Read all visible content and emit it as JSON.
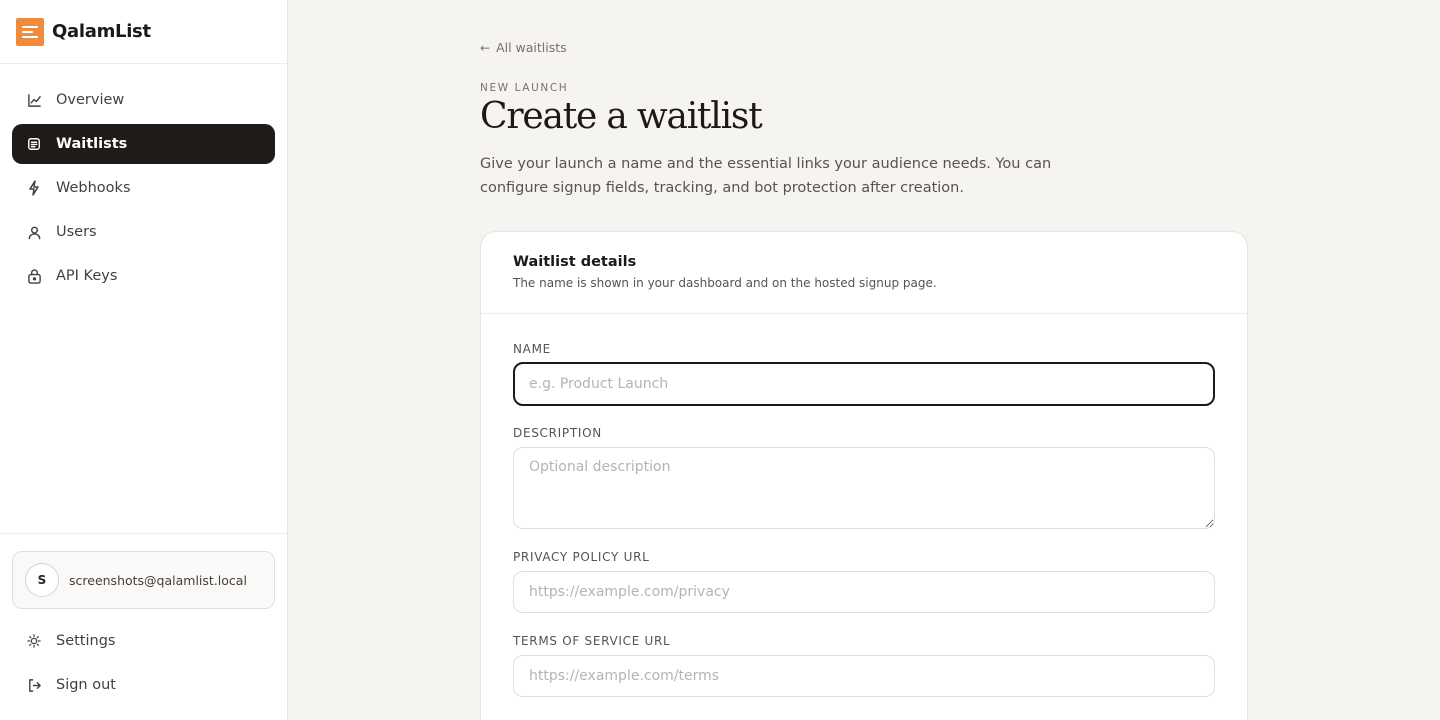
{
  "app": {
    "name": "QalamList",
    "accent": "#f08a3c"
  },
  "sidebar": {
    "items": [
      {
        "label": "Overview",
        "icon": "chart-line-icon"
      },
      {
        "label": "Waitlists",
        "icon": "list-icon"
      },
      {
        "label": "Webhooks",
        "icon": "bolt-icon"
      },
      {
        "label": "Users",
        "icon": "user-icon"
      },
      {
        "label": "API Keys",
        "icon": "lock-icon"
      }
    ],
    "active_item": "Waitlists",
    "user": {
      "avatar_initial": "S",
      "email": "screenshots@qalamlist.local"
    },
    "bottom_items": [
      {
        "label": "Settings",
        "icon": "sun-icon"
      },
      {
        "label": "Sign out",
        "icon": "sign-out-icon"
      }
    ]
  },
  "main": {
    "back_link": "All waitlists",
    "eyebrow": "NEW LAUNCH",
    "title": "Create a waitlist",
    "description": "Give your launch a name and the essential links your audience needs. You can configure signup fields, tracking, and bot protection after creation.",
    "card": {
      "title": "Waitlist details",
      "subtitle": "The name is shown in your dashboard and on the hosted signup page.",
      "fields": {
        "name": {
          "label": "NAME",
          "placeholder": "e.g. Product Launch",
          "value": ""
        },
        "description": {
          "label": "DESCRIPTION",
          "placeholder": "Optional description",
          "value": ""
        },
        "privacy": {
          "label": "PRIVACY POLICY URL",
          "placeholder": "https://example.com/privacy",
          "value": ""
        },
        "terms": {
          "label": "TERMS OF SERVICE URL",
          "placeholder": "https://example.com/terms",
          "value": ""
        }
      }
    }
  }
}
